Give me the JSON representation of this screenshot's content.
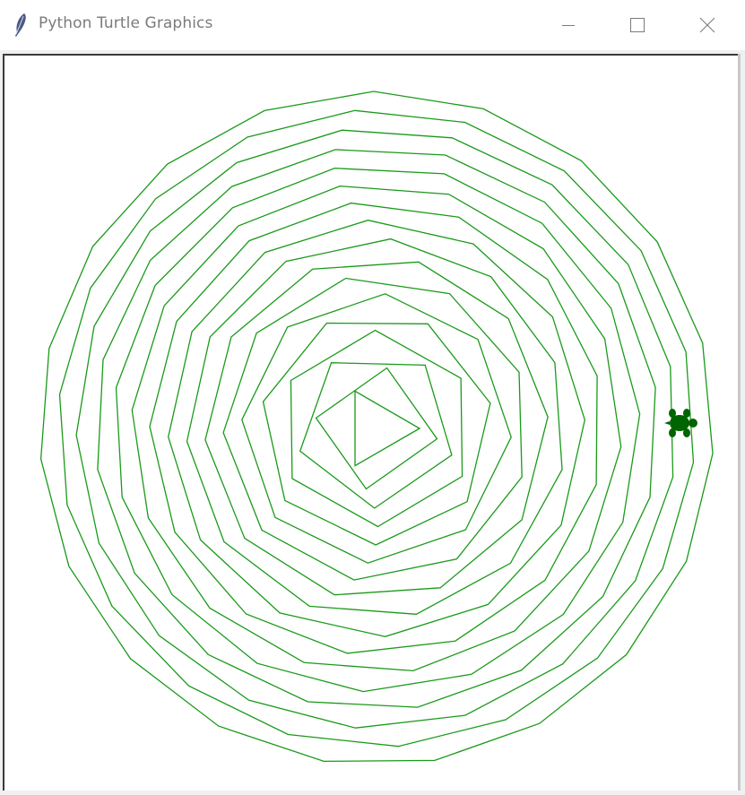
{
  "window": {
    "title": "Python Turtle Graphics"
  },
  "icons": {
    "app": "feather-icon",
    "minimize": "minimize-icon",
    "maximize": "maximize-icon",
    "close": "close-icon",
    "turtle": "turtle-icon"
  },
  "colors": {
    "pen": "#1a9a1a",
    "turtle_fill": "#006400",
    "canvas_bg": "#ffffff",
    "titlebar_bg": "#ffffff",
    "title_text": "#7b7b7b"
  }
}
